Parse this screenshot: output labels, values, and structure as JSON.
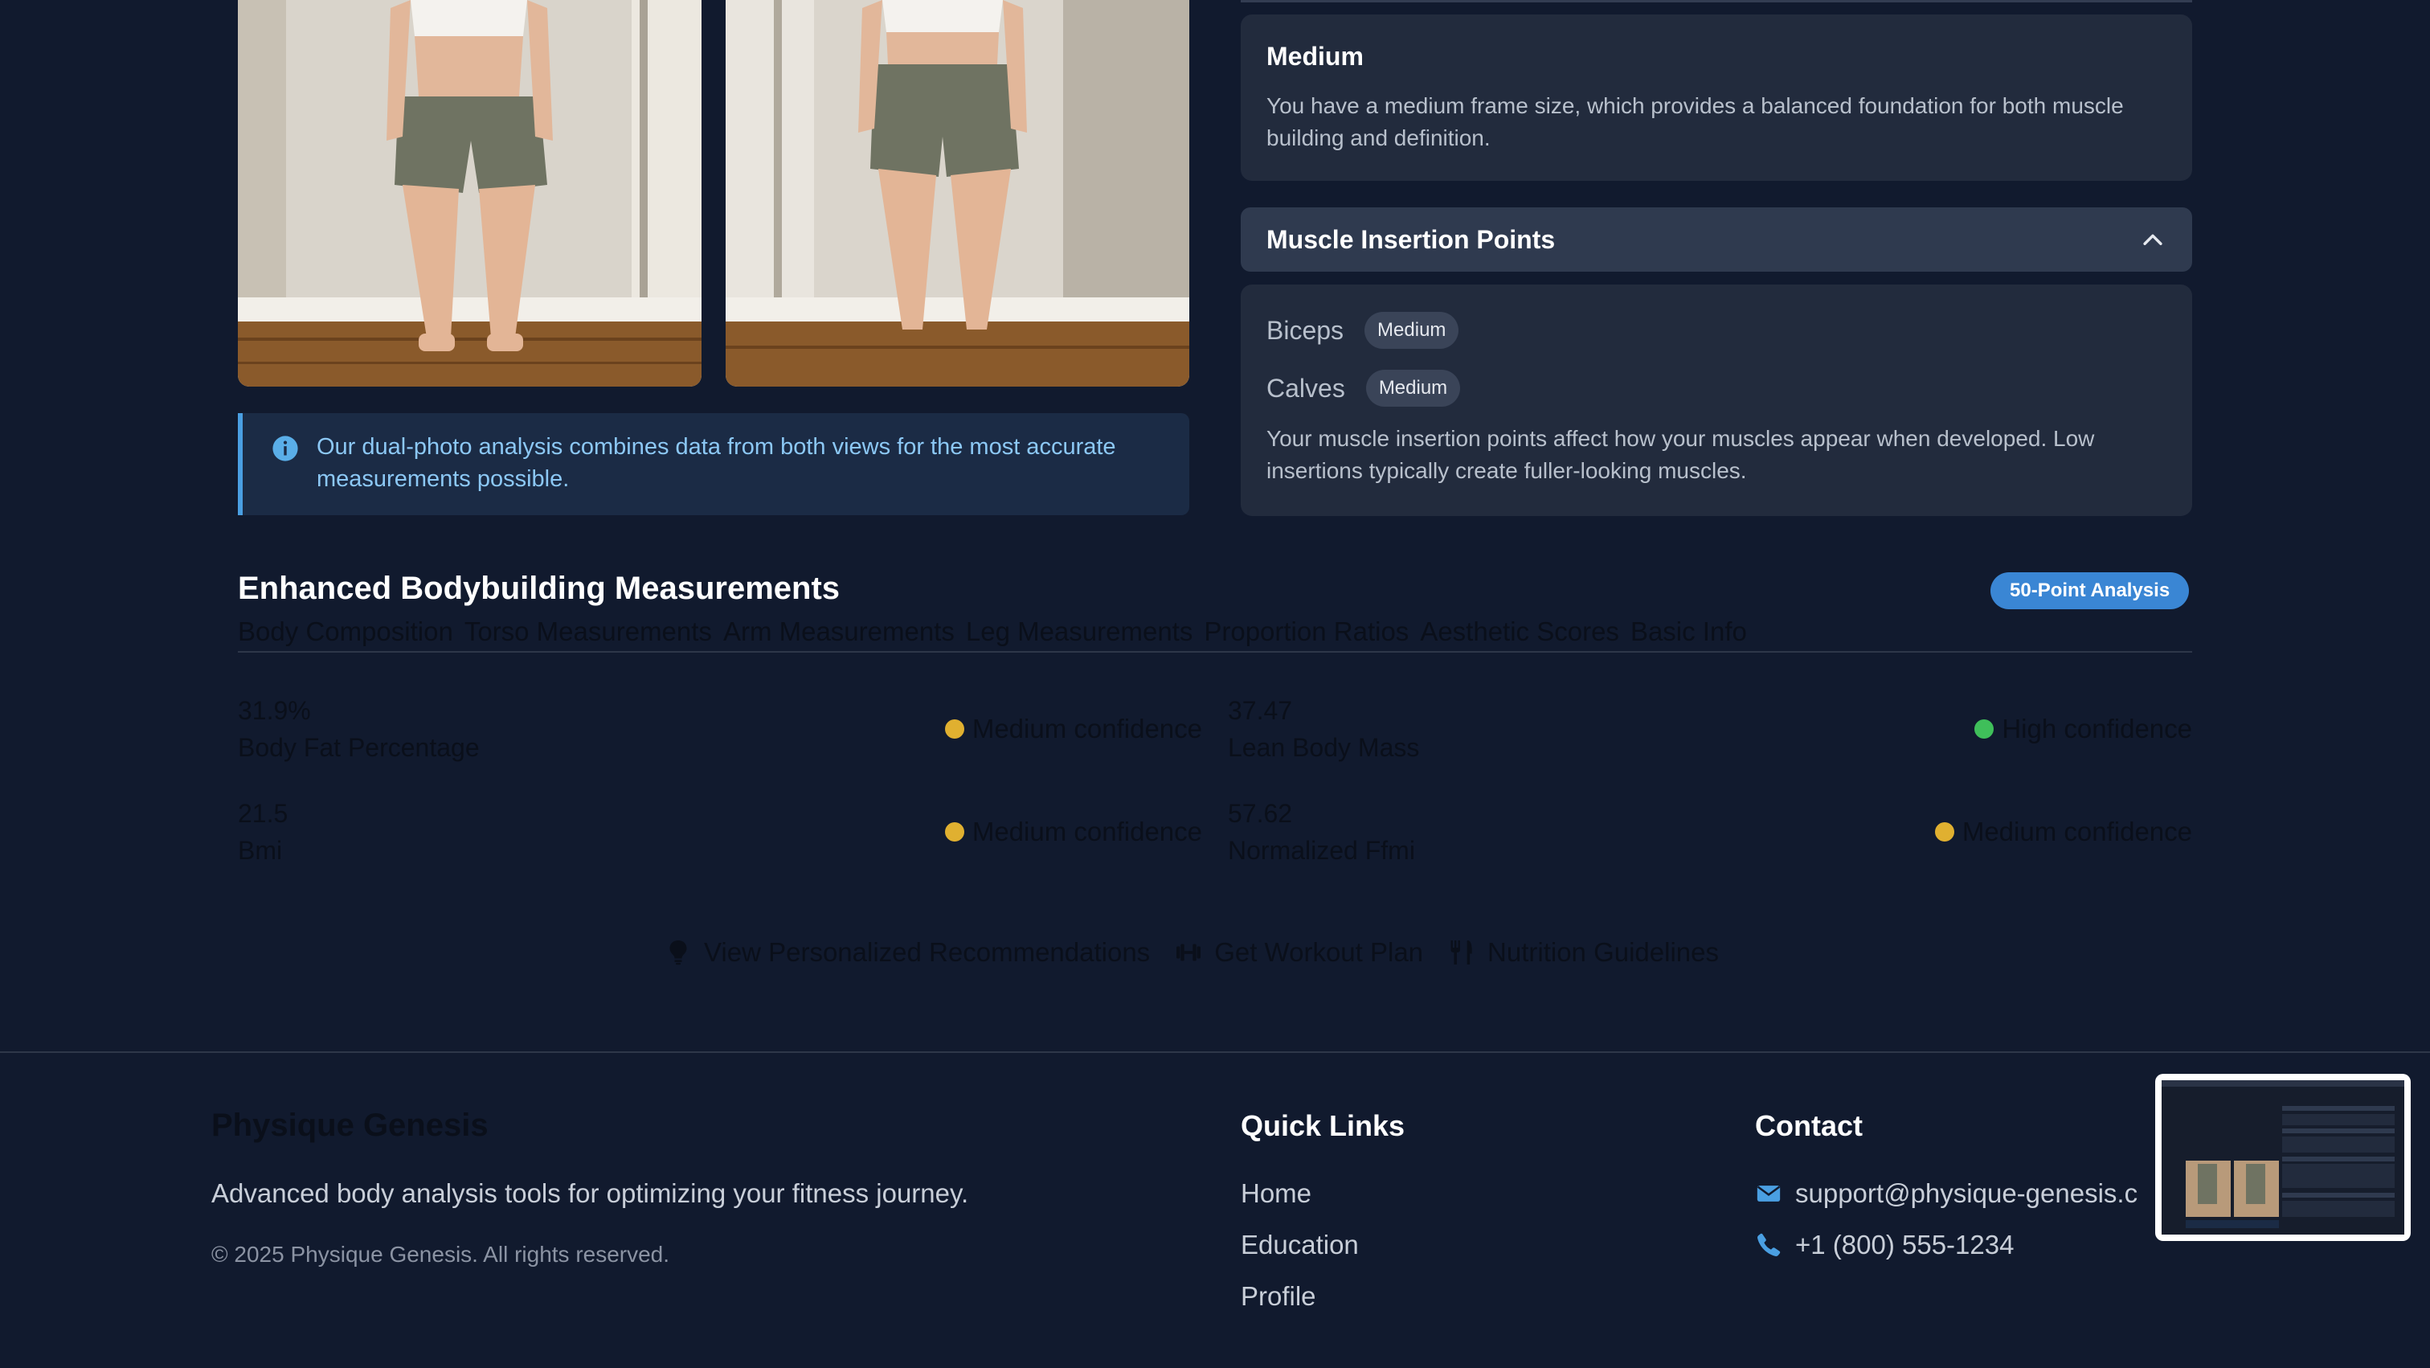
{
  "info_box": {
    "text": "Our dual-photo analysis combines data from both views for the most accurate measurements possible."
  },
  "frame": {
    "title": "Medium",
    "description": "You have a medium frame size, which provides a balanced foundation for both muscle building and definition."
  },
  "muscle_insertion": {
    "title": "Muscle Insertion Points",
    "items": [
      {
        "label": "Biceps",
        "value": "Medium"
      },
      {
        "label": "Calves",
        "value": "Medium"
      }
    ],
    "description": "Your muscle insertion points affect how your muscles appear when developed. Low insertions typically create fuller-looking muscles."
  },
  "measurements": {
    "title": "Enhanced Bodybuilding Measurements",
    "badge": "50-Point Analysis",
    "tabs": [
      "Body Composition",
      "Torso Measurements",
      "Arm Measurements",
      "Leg Measurements",
      "Proportion Ratios",
      "Aesthetic Scores",
      "Basic Info"
    ],
    "metrics": [
      {
        "value": "31.9%",
        "name": "Body Fat Percentage",
        "confidence": "Medium confidence",
        "confidence_color": "#e0b030"
      },
      {
        "value": "37.47",
        "name": "Lean Body Mass",
        "confidence": "High confidence",
        "confidence_color": "#3fbf5a"
      },
      {
        "value": "21.5",
        "name": "Bmi",
        "confidence": "Medium confidence",
        "confidence_color": "#e0b030"
      },
      {
        "value": "57.62",
        "name": "Normalized Ffmi",
        "confidence": "Medium confidence",
        "confidence_color": "#e0b030"
      }
    ]
  },
  "actions": [
    {
      "label": "View Personalized Recommendations",
      "icon": "lightbulb-icon"
    },
    {
      "label": "Get Workout Plan",
      "icon": "dumbbell-icon"
    },
    {
      "label": "Nutrition Guidelines",
      "icon": "utensils-icon"
    }
  ],
  "footer": {
    "brand": "Physique Genesis",
    "tagline": "Advanced body analysis tools for optimizing your fitness journey.",
    "copyright": "© 2025 Physique Genesis. All rights reserved.",
    "quick_links_title": "Quick Links",
    "links": [
      "Home",
      "Education",
      "Profile"
    ],
    "contact_title": "Contact",
    "email": "support@physique-genesis.c",
    "phone": "+1 (800) 555-1234"
  },
  "colors": {
    "background": "#111a2e",
    "card": "#222b3d",
    "accent": "#3a86d4",
    "info_text": "#8cc8f5"
  }
}
